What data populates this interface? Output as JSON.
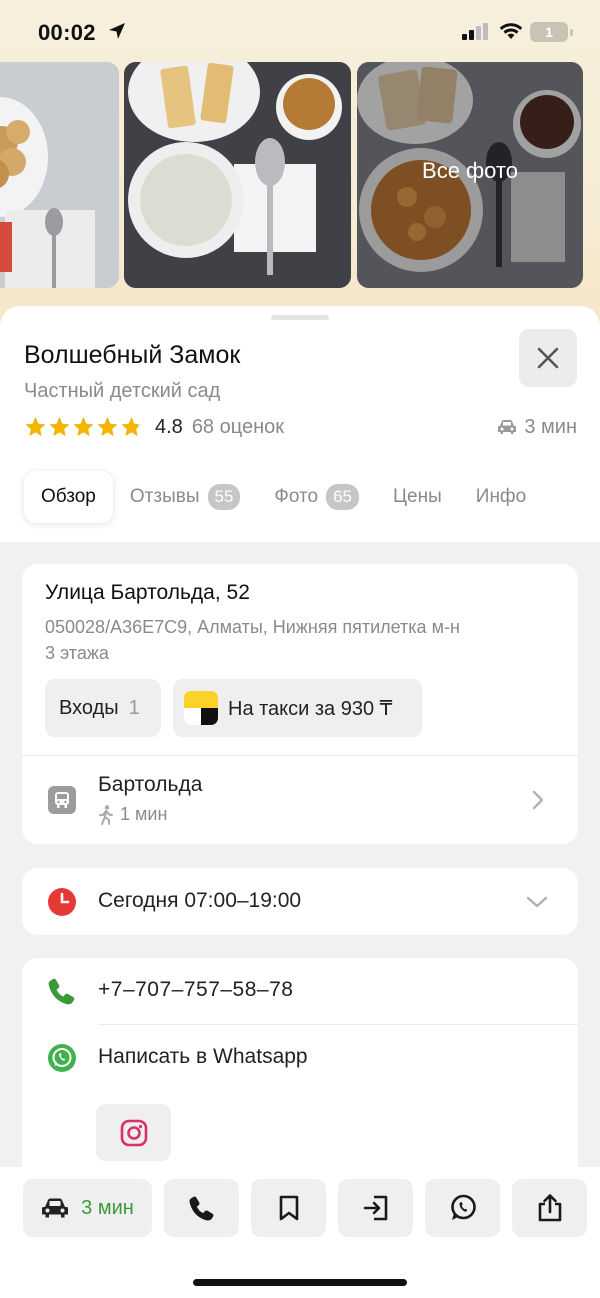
{
  "status_bar": {
    "time": "00:02",
    "battery": "1"
  },
  "photos": {
    "all_photos_label": "Все фото"
  },
  "place": {
    "name": "Волшебный Замок",
    "category": "Частный детский сад",
    "rating": "4.8",
    "rating_count": "68 оценок",
    "rating_stars": 4.8,
    "drive_time": "3 мин"
  },
  "tabs": [
    {
      "label": "Обзор",
      "badge": null,
      "active": true
    },
    {
      "label": "Отзывы",
      "badge": "55",
      "active": false
    },
    {
      "label": "Фото",
      "badge": "65",
      "active": false
    },
    {
      "label": "Цены",
      "badge": null,
      "active": false
    },
    {
      "label": "Инфо",
      "badge": null,
      "active": false
    }
  ],
  "address": {
    "street": "Улица Бартольда, 52",
    "details": "050028/A36E7C9, Алматы, Нижняя пятилетка м-н",
    "floors": "3 этажа",
    "entrances_label": "Входы",
    "entrances_count": "1",
    "taxi_label": "На такси за 930 ₸"
  },
  "transit": {
    "stop_name": "Бартольда",
    "walk_time": "1 мин"
  },
  "hours": {
    "text": "Сегодня 07:00–19:00"
  },
  "contacts": {
    "phone": "+7‒707‒757‒58‒78",
    "whatsapp_label": "Написать в Whatsapp"
  },
  "bottom_bar": {
    "route_time": "3 мин"
  },
  "colors": {
    "star": "#f4b400",
    "phone_green": "#3a9a3a",
    "whatsapp_green": "#3fb24e",
    "clock_red": "#e53935",
    "instagram": "#d92f6a",
    "taxi_yellow": "#fcd12a"
  },
  "icons": [
    "location-arrow-icon",
    "signal-icon",
    "wifi-icon",
    "close-icon",
    "star-icon",
    "car-icon",
    "bus-stop-icon",
    "walk-icon",
    "chevron-right-icon",
    "clock-icon",
    "chevron-down-icon",
    "phone-icon",
    "whatsapp-icon",
    "instagram-icon",
    "bookmark-icon",
    "entrance-icon",
    "share-icon"
  ]
}
